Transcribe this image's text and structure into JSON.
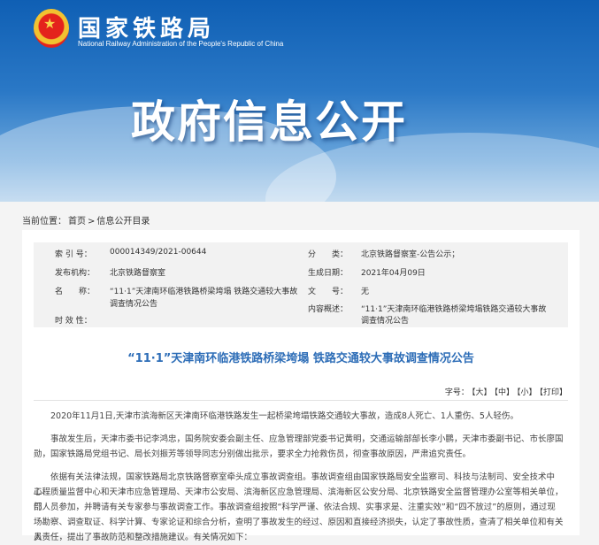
{
  "header": {
    "site_name": "国家铁路局",
    "site_subtitle": "National Railway Administration of the People's Republic of China",
    "banner_title": "政府信息公开"
  },
  "breadcrumb": {
    "prefix": "当前位置：",
    "home": "首页",
    "separator": ">",
    "current": "信息公开目录"
  },
  "meta": {
    "index_label": "索 引 号：",
    "index_value": "000014349/2021-00644",
    "category_label": "分　　类：",
    "category_value": "北京铁路督察室-公告公示；",
    "publisher_label": "发布机构：",
    "publisher_value": "北京铁路督察室",
    "date_label": "生成日期：",
    "date_value": "2021年04月09日",
    "name_label": "名　　称：",
    "name_value_line1": "“11·1”天津南环临港铁路桥梁垮塌 铁路交通较大事故",
    "name_value_line2": "调查情况公告",
    "docno_label": "文　　号：",
    "docno_value": "无",
    "summary_label": "内容概述：",
    "summary_value_line1": "“11·1”天津南环临港铁路桥梁垮塌铁路交通较大事故",
    "summary_value_line2": "调查情况公告",
    "validity_label": "时 效 性："
  },
  "article": {
    "title": "“11·1”天津南环临港铁路桥梁垮塌 铁路交通较大事故调查情况公告",
    "fontsize_label": "字号：",
    "font_large": "【大】",
    "font_medium": "【中】",
    "font_small": "【小】",
    "print": "【打印】",
    "p1": "2020年11月1日,天津市滨海新区天津南环临港铁路发生一起桥梁垮塌铁路交通较大事故，造成8人死亡、1人重伤、5人轻伤。",
    "p2_line1": "事故发生后，天津市委书记李鸿忠，国务院安委会副主任、应急管理部党委书记黄明，交通运输部部长李小鹏，天津市委副书记、市长廖国",
    "p2_line2": "勋，国家铁路局党组书记、局长刘振芳等领导同志分别做出批示，要求全力抢救伤员，彻查事故原因，严肃追究责任。",
    "p3_line1": "依据有关法律法规，国家铁路局北京铁路督察室牵头成立事故调查组。事故调查组由国家铁路局安全监察司、科技与法制司、安全技术中心、",
    "p3_line2": "工程质量监督中心和天津市应急管理局、天津市公安局、滨海新区应急管理局、滨海新区公安分局、北京铁路安全监督管理办公室等相关单位，部",
    "p3_line3": "门人员参加，并聘请有关专家参与事故调查工作。事故调查组按照“科学严谨、依法合规、实事求是、注重实效”和“四不放过”的原则，通过现",
    "p3_line4": "场勘察、调查取证、科学计算、专家论证和综合分析，查明了事故发生的经过、原因和直接经济损失，认定了事故性质，查清了相关单位和有关人",
    "p3_line5": "员责任，提出了事故防范和整改措施建议。有关情况如下："
  }
}
